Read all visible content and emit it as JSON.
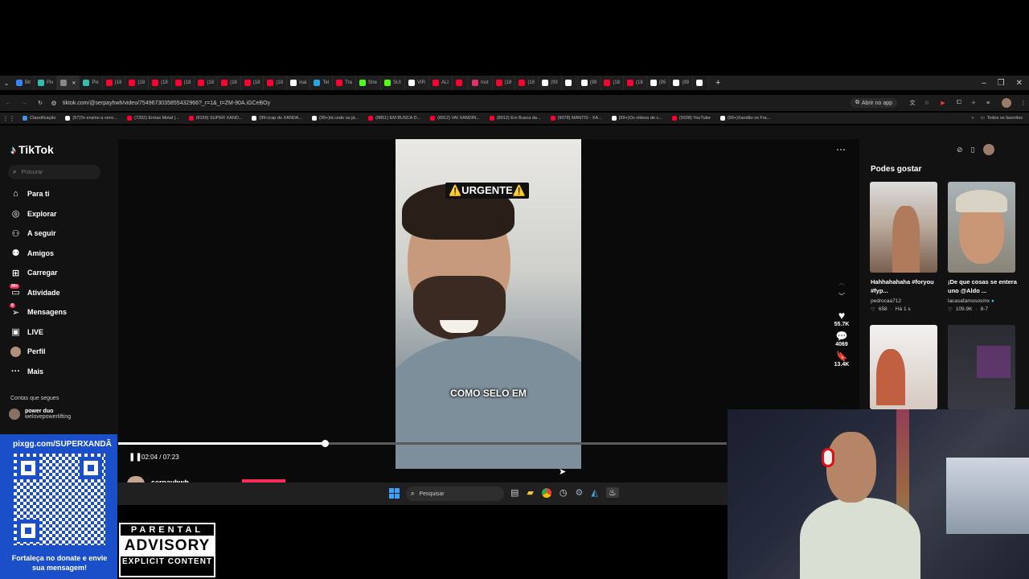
{
  "browser": {
    "tabs": [
      {
        "label": "Bit",
        "color": "#3b82f6"
      },
      {
        "label": "Pix",
        "color": "#32bcad"
      },
      {
        "label": "",
        "color": "#888888",
        "active": true
      },
      {
        "label": "Pix",
        "color": "#32bcad"
      },
      {
        "label": "(18",
        "color": "#ff0033"
      },
      {
        "label": "(18",
        "color": "#ff0033"
      },
      {
        "label": "(18",
        "color": "#ff0033"
      },
      {
        "label": "(18",
        "color": "#ff0033"
      },
      {
        "label": "(18",
        "color": "#ff0033"
      },
      {
        "label": "(18",
        "color": "#ff0033"
      },
      {
        "label": "(18",
        "color": "#ff0033"
      },
      {
        "label": "(18",
        "color": "#ff0033"
      },
      {
        "label": "Isai",
        "color": "#ffffff"
      },
      {
        "label": "Tel",
        "color": "#2aa3e0"
      },
      {
        "label": "Tra",
        "color": "#ff0033"
      },
      {
        "label": "Stre",
        "color": "#53fc18"
      },
      {
        "label": "SUI",
        "color": "#53fc18"
      },
      {
        "label": "VIR",
        "color": "#ffffff"
      },
      {
        "label": "ALI",
        "color": "#ff0033"
      },
      {
        "label": "",
        "color": "#ff0033"
      },
      {
        "label": "Inst",
        "color": "#e1306c"
      },
      {
        "label": "(18",
        "color": "#ff0033"
      },
      {
        "label": "(18",
        "color": "#ff0033"
      },
      {
        "label": "(99",
        "color": "#ffffff"
      },
      {
        "label": "",
        "color": "#ffffff"
      },
      {
        "label": "(99",
        "color": "#ffffff"
      },
      {
        "label": "(18",
        "color": "#ff0033"
      },
      {
        "label": "(18",
        "color": "#ff0033"
      },
      {
        "label": "(95",
        "color": "#ffffff"
      },
      {
        "label": "(99",
        "color": "#ffffff"
      },
      {
        "label": "",
        "color": "#ffffff"
      }
    ],
    "url": "tiktok.com/@serpayhwh/video/7549673035855432966?_r=1&_t=ZM-90A.iGCeBOy",
    "open_in_app": "Abrir no app",
    "bookmarks": [
      {
        "label": "Classificação",
        "color": "#4a90e2"
      },
      {
        "label": "(57)Te ensino a venc...",
        "color": "#ffffff"
      },
      {
        "label": "(7292) Enéas Metal |...",
        "color": "#ff0033"
      },
      {
        "label": "(8159) SUPER XAND...",
        "color": "#ff0033"
      },
      {
        "label": "(99+)rap do XANDÃ...",
        "color": "#ffffff"
      },
      {
        "label": "(99+)tá cedo ou já...",
        "color": "#ffffff"
      },
      {
        "label": "(8851) EM BUSCA D...",
        "color": "#ff0033"
      },
      {
        "label": "(8912) VAI XANDIN...",
        "color": "#ff0033"
      },
      {
        "label": "(8912) Em Busca da...",
        "color": "#ff0033"
      },
      {
        "label": "(9078) MANTIS - XA...",
        "color": "#ff0033"
      },
      {
        "label": "(99+)Os vídeos de c...",
        "color": "#ffffff"
      },
      {
        "label": "(9338) YouTube",
        "color": "#ff0033"
      },
      {
        "label": "(99+)Xandão vs Fra...",
        "color": "#ffffff"
      }
    ],
    "all_favorites": "Todos os favoritos"
  },
  "tiktok": {
    "logo": "TikTok",
    "search_placeholder": "Procurar",
    "nav": [
      {
        "name": "for-you",
        "label": "Para ti",
        "icon": "home-icon"
      },
      {
        "name": "explore",
        "label": "Explorar",
        "icon": "compass-icon"
      },
      {
        "name": "following",
        "label": "A seguir",
        "icon": "user-plus-icon"
      },
      {
        "name": "friends",
        "label": "Amigos",
        "icon": "friends-icon"
      },
      {
        "name": "upload",
        "label": "Carregar",
        "icon": "upload-icon"
      },
      {
        "name": "activity",
        "label": "Atividade",
        "icon": "inbox-icon",
        "badge": "99+"
      },
      {
        "name": "messages",
        "label": "Mensagens",
        "icon": "send-icon",
        "badge": "8"
      },
      {
        "name": "live",
        "label": "LIVE",
        "icon": "live-icon"
      },
      {
        "name": "profile",
        "label": "Perfil",
        "icon": "avatar-icon"
      },
      {
        "name": "more",
        "label": "Mais",
        "icon": "ellipsis-icon"
      }
    ],
    "following_title": "Contas que segues",
    "following_account": {
      "name": "power duo",
      "handle": "welovepowerlifting"
    },
    "video": {
      "caption_top": "⚠️URGENTE⚠️",
      "caption_mid": "COMO SELO EM",
      "time": "02:04 / 07:23",
      "progress": 0.34,
      "author": "serpayhwh",
      "likes": "55.7K",
      "comments": "4069",
      "saves": "13.4K"
    },
    "suggested_title": "Podes gostar",
    "suggested": [
      {
        "title": "Hahhahahaha #foryou #fyp...",
        "author": "pedrocaa712",
        "likes": "658",
        "age": "Há 1 s"
      },
      {
        "title": "¡De que cosas se entera uno @Aldo ...",
        "author": "lacasafamososmx",
        "likes": "109.9K",
        "age": "8-7"
      }
    ]
  },
  "taskbar": {
    "search_placeholder": "Pesquisar"
  },
  "overlay": {
    "donate_url": "pixgg.com/SUPERXANDÃ",
    "donate_text": "Fortaleça no donate e envie sua mensagem!",
    "advisory_top": "PARENTAL",
    "advisory_mid": "ADVISORY",
    "advisory_bottom": "EXPLICIT CONTENT"
  },
  "colors": {
    "accent": "#fe2c55",
    "donate_bg": "#1b4fc9"
  }
}
